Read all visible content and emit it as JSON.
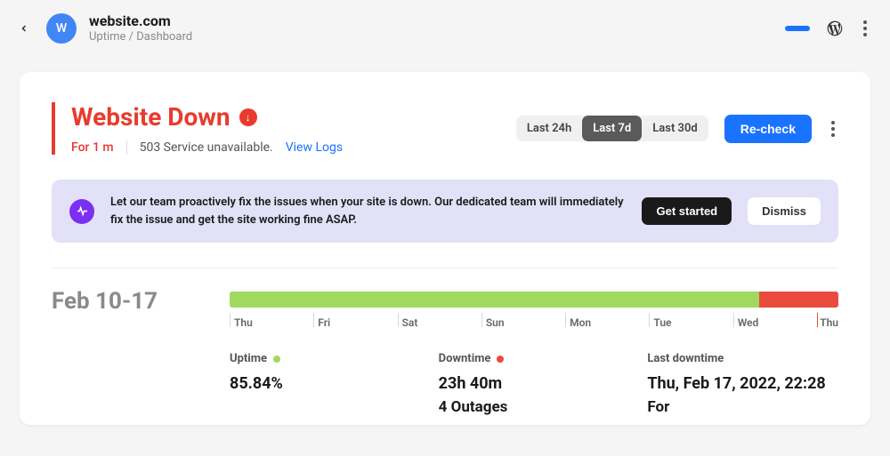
{
  "header": {
    "avatar_letter": "W",
    "site_title": "website.com",
    "breadcrumb": "Uptime / Dashboard"
  },
  "status": {
    "title": "Website Down",
    "down_arrow": "↓",
    "for_label": "For 1 m",
    "error_text": "503 Service unavailable.",
    "view_logs_label": "View Logs"
  },
  "range": {
    "tabs": [
      {
        "label": "Last 24h",
        "active": false
      },
      {
        "label": "Last 7d",
        "active": true
      },
      {
        "label": "Last 30d",
        "active": false
      }
    ],
    "recheck_label": "Re-check"
  },
  "banner": {
    "text": "Let our team proactively fix the issues when your site is down. Our dedicated team will immediately fix the issue and get the site working fine ASAP.",
    "get_started_label": "Get started",
    "dismiss_label": "Dismiss"
  },
  "chart": {
    "date_range_label": "Feb 10-17"
  },
  "chart_data": {
    "type": "bar",
    "title": "Uptime Feb 10-17",
    "categories": [
      "Thu",
      "Fri",
      "Sat",
      "Sun",
      "Mon",
      "Tue",
      "Wed",
      "Thu"
    ],
    "series": [
      {
        "name": "up",
        "color": "#a0d860",
        "percent": 87
      },
      {
        "name": "down",
        "color": "#e94b3c",
        "percent": 13
      }
    ],
    "xlabel": "",
    "ylabel": ""
  },
  "stats": {
    "uptime_label": "Uptime",
    "uptime_value": "85.84%",
    "downtime_label": "Downtime",
    "downtime_value": "23h 40m",
    "outages_value": "4 Outages",
    "last_downtime_label": "Last downtime",
    "last_downtime_value": "Thu, Feb 17, 2022, 22:28",
    "last_downtime_for": "For"
  }
}
